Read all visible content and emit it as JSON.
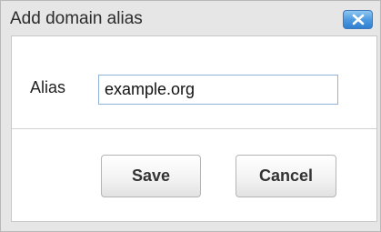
{
  "dialog": {
    "title": "Add domain alias",
    "close_icon": "close-icon"
  },
  "form": {
    "alias_label": "Alias",
    "alias_value": "example.org"
  },
  "actions": {
    "save_label": "Save",
    "cancel_label": "Cancel"
  },
  "colors": {
    "close_button": "#4e9be0",
    "input_border": "#8fb2d8",
    "dialog_background": "#e6e6e6"
  }
}
